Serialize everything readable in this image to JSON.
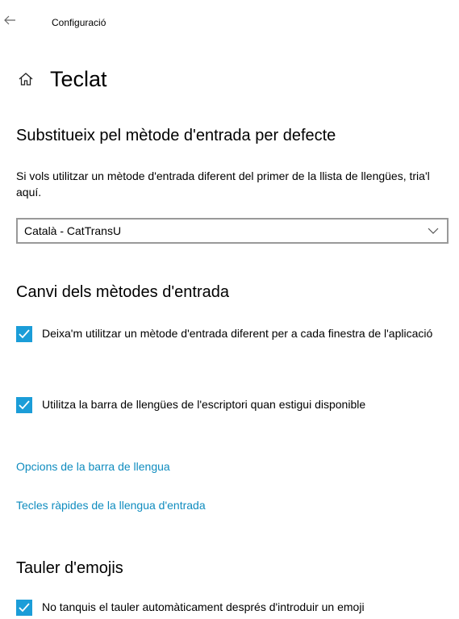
{
  "window": {
    "back_icon": "back-arrow-icon",
    "app_title": "Configuració"
  },
  "header": {
    "icon": "home-icon",
    "title": "Teclat"
  },
  "override_section": {
    "title": "Substitueix pel mètode d'entrada per defecte",
    "description": "Si vols utilitzar un mètode d'entrada diferent del primer de la llista de llengües, tria'l aquí.",
    "dropdown": {
      "selected": "Català - CatTransU",
      "icon": "chevron-down-icon"
    }
  },
  "switching_section": {
    "title": "Canvi dels mètodes d'entrada",
    "checkboxes": [
      {
        "label": "Deixa'm utilitzar un mètode d'entrada diferent per a cada finestra de l'aplicació",
        "checked": true
      },
      {
        "label": "Utilitza la barra de llengües de l'escriptori quan estigui disponible",
        "checked": true
      }
    ],
    "links": [
      "Opcions de la barra de llengua",
      "Tecles ràpides de la llengua d'entrada"
    ]
  },
  "emoji_section": {
    "title": "Tauler d'emojis",
    "checkboxes": [
      {
        "label": "No tanquis el tauler automàticament després d'introduir un emoji",
        "checked": true
      }
    ]
  },
  "colors": {
    "accent": "#1b9dd8",
    "link": "#0f8cbf",
    "border": "#999999"
  }
}
